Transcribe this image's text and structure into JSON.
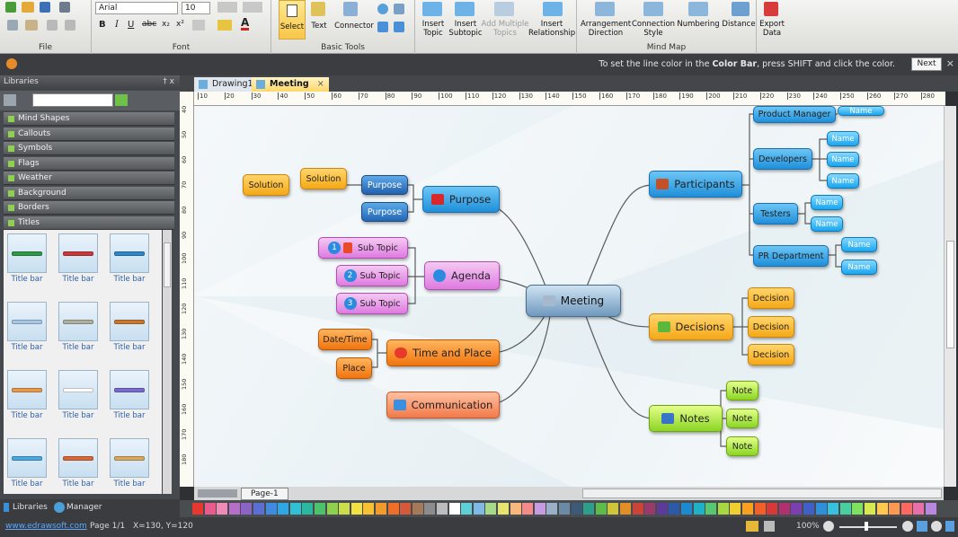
{
  "ribbon": {
    "font_name": "Arial",
    "font_size": "10",
    "groups": {
      "file": "File",
      "font": "Font",
      "basic_tools": "Basic Tools",
      "mind_map": "Mind Map"
    },
    "buttons": {
      "select": "Select",
      "text": "Text",
      "connector": "Connector",
      "insert_topic": "Insert\nTopic",
      "insert_subtopic": "Insert\nSubtopic",
      "add_multiple_topics": "Add Multiple\nTopics",
      "insert_relationship": "Insert\nRelationship",
      "arrangement_direction": "Arrangement\nDirection",
      "connection_style": "Connection\nStyle",
      "numbering": "Numbering",
      "distance": "Distance",
      "export_data": "Export\nData"
    }
  },
  "message_bar": {
    "text_before": "To set the line color in the ",
    "text_bold": "Color Bar",
    "text_after": ", press SHIFT and click the color.",
    "next_label": "Next"
  },
  "libraries": {
    "title": "Libraries",
    "pin_close": "† x",
    "categories": [
      "Mind Shapes",
      "Callouts",
      "Symbols",
      "Flags",
      "Weather",
      "Background",
      "Borders",
      "Titles"
    ],
    "thumb_label": "Title bar",
    "thumb_colors": [
      "#2f9a45",
      "#c83a3a",
      "#2e88c8",
      "#a8c8e8",
      "#b0b0a0",
      "#c87830",
      "#e89a4a",
      "#ffffff",
      "#7a6ad0",
      "#4aa8e0",
      "#d86838",
      "#d8a860"
    ],
    "tabs": {
      "libraries": "Libraries",
      "manager": "Manager"
    }
  },
  "doc_tabs": [
    "Drawing1",
    "Meeting"
  ],
  "ruler_marks": [
    "10",
    "20",
    "30",
    "40",
    "50",
    "60",
    "70",
    "80",
    "90",
    "100",
    "110",
    "120",
    "130",
    "140",
    "150",
    "160",
    "170",
    "180",
    "190",
    "200",
    "210",
    "220",
    "230",
    "240",
    "250",
    "260",
    "270",
    "280"
  ],
  "vruler_marks": [
    "40",
    "50",
    "60",
    "70",
    "80",
    "90",
    "100",
    "110",
    "120",
    "130",
    "140",
    "150",
    "160",
    "170",
    "180"
  ],
  "page_tab": "Page-1",
  "mindmap": {
    "central": "Meeting",
    "purpose": {
      "label": "Purpose",
      "children": [
        "Purpose",
        "Purpose"
      ],
      "solution": "Solution",
      "solution2": "Solution"
    },
    "agenda": {
      "label": "Agenda",
      "children": [
        "Sub Topic",
        "Sub Topic",
        "Sub Topic"
      ],
      "numbers": [
        "1",
        "2",
        "3"
      ]
    },
    "time_place": {
      "label": "Time and Place",
      "children": [
        "Date/Time",
        "Place"
      ]
    },
    "communication": {
      "label": "Communication"
    },
    "participants": {
      "label": "Participants",
      "product_manager": "Product Manager",
      "product_manager_child": "Name",
      "developers": "Developers",
      "testers": "Testers",
      "pr_department": "PR Department",
      "name": "Name"
    },
    "decisions": {
      "label": "Decisions",
      "children": [
        "Decision",
        "Decision",
        "Decision"
      ]
    },
    "notes": {
      "label": "Notes",
      "children": [
        "Note",
        "Note",
        "Note"
      ]
    }
  },
  "palette_colors": [
    "#e6382f",
    "#e95b8d",
    "#f08bb8",
    "#b76ec9",
    "#8b64c6",
    "#5a6fd1",
    "#3f8be0",
    "#2ea7e6",
    "#30c0d6",
    "#2bb7a0",
    "#4cc26b",
    "#8fd14f",
    "#c9de4a",
    "#f2e241",
    "#f6c234",
    "#f39a2c",
    "#ef6f2a",
    "#d65a3a",
    "#a47a5a",
    "#8c8c8c",
    "#bdbdbd",
    "#ffffff",
    "#5fd0d8",
    "#7fb9e6",
    "#a7d98b",
    "#e6e36f",
    "#f7b77d",
    "#f58a8a",
    "#c79be0",
    "#9ab0c8",
    "#6b8aa6",
    "#3c5a78",
    "#2d9e8c",
    "#5dbb4a",
    "#d0c43a",
    "#e08f28",
    "#c9453a",
    "#9a3a6a",
    "#5e3a9a",
    "#2a5aa8",
    "#1b8ad0",
    "#20b0c8",
    "#58c870",
    "#a8d840",
    "#f0d030",
    "#f8a020",
    "#f06028",
    "#d83838",
    "#b03070",
    "#7a40b0",
    "#4060c8",
    "#2f8fd8",
    "#38c0e0",
    "#48d0a0",
    "#80e060",
    "#d8e850",
    "#ffc850",
    "#ff9850",
    "#ff6860",
    "#e870a8",
    "#b888e0"
  ],
  "status": {
    "link": "www.edrawsoft.com",
    "page": "Page 1/1",
    "coords": "X=130, Y=120",
    "zoom": "100%"
  }
}
